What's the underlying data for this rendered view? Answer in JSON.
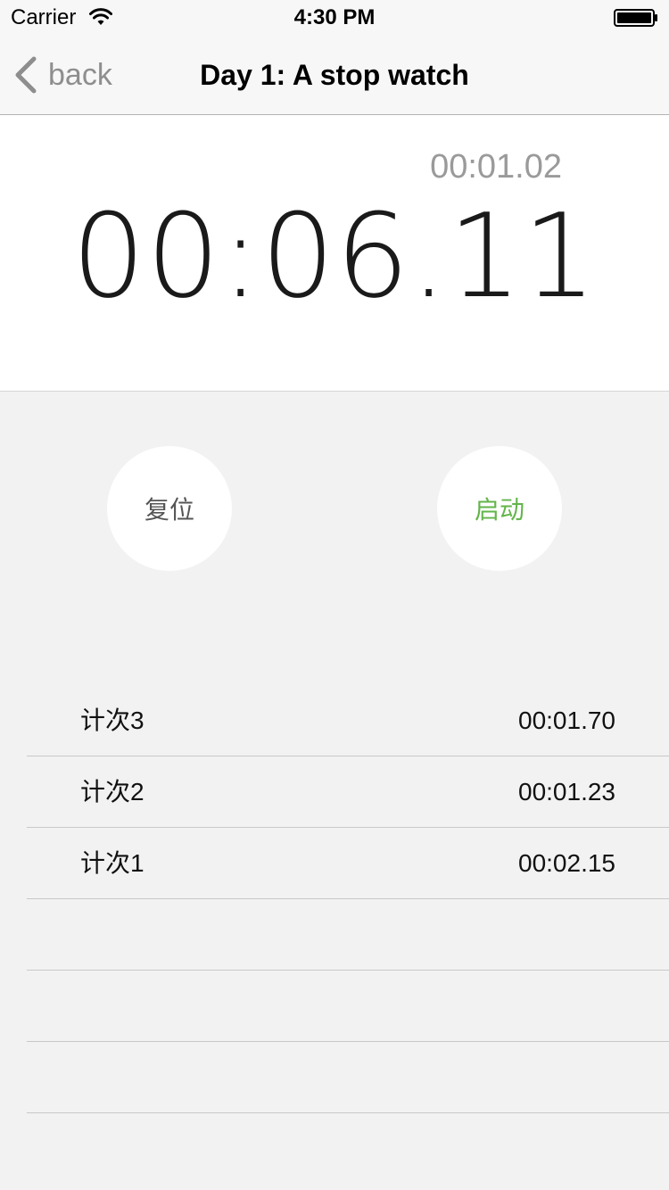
{
  "status_bar": {
    "carrier": "Carrier",
    "time": "4:30 PM",
    "icons": [
      "wifi-icon",
      "battery-icon"
    ]
  },
  "nav": {
    "back_label": "back",
    "title": "Day 1: A stop watch",
    "back_icon": "chevron-left-icon"
  },
  "timer": {
    "lap_time": "00:01.02",
    "main_time": "00:06.11"
  },
  "controls": {
    "reset_label": "复位",
    "start_label": "启动",
    "start_color": "#62b54a"
  },
  "laps": [
    {
      "name": "计次3",
      "time": "00:01.70"
    },
    {
      "name": "计次2",
      "time": "00:01.23"
    },
    {
      "name": "计次1",
      "time": "00:02.15"
    },
    {
      "name": "",
      "time": ""
    },
    {
      "name": "",
      "time": ""
    },
    {
      "name": "",
      "time": ""
    }
  ]
}
